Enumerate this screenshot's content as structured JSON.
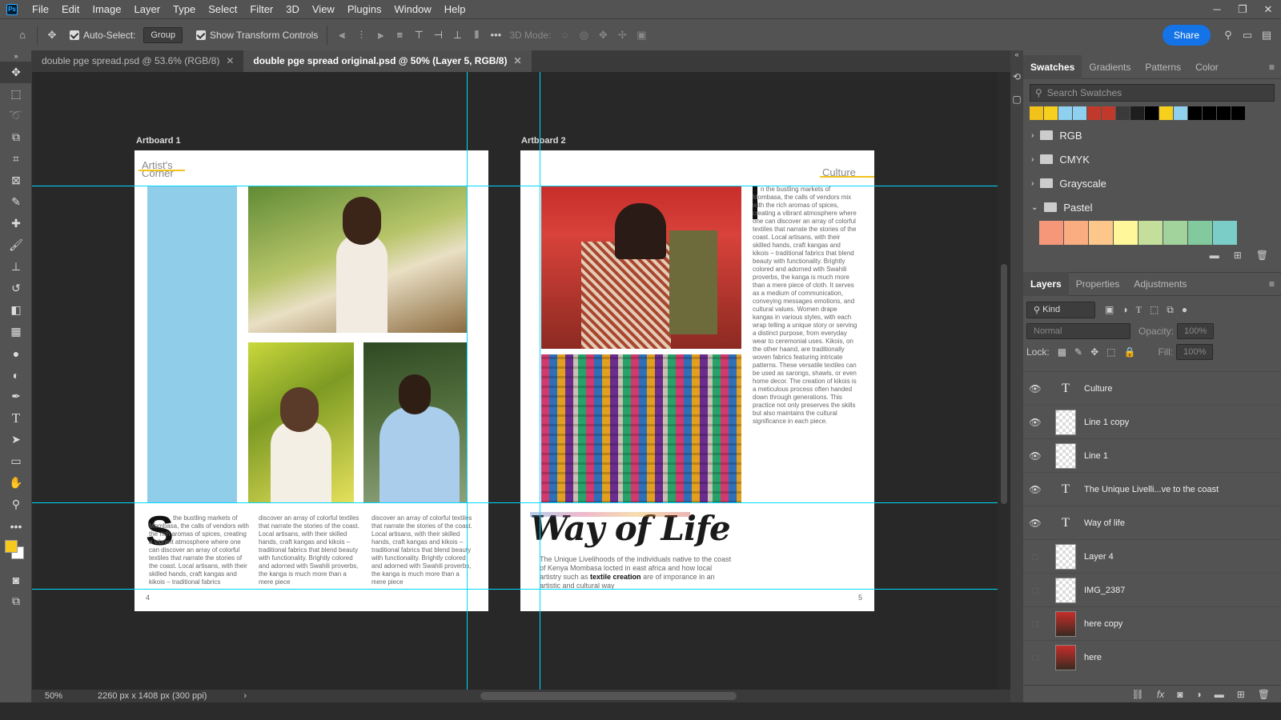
{
  "menubar": {
    "logo": "Ps",
    "items": [
      "File",
      "Edit",
      "Image",
      "Layer",
      "Type",
      "Select",
      "Filter",
      "3D",
      "View",
      "Plugins",
      "Window",
      "Help"
    ]
  },
  "options": {
    "auto_select": "Auto-Select:",
    "group": "Group",
    "transform": "Show Transform Controls",
    "mode3d": "3D Mode:",
    "share": "Share"
  },
  "tabs": [
    {
      "label": "double pge spread.psd @ 53.6% (RGB/8)"
    },
    {
      "label": "double pge spread original.psd @ 50% (Layer 5, RGB/8)"
    }
  ],
  "boards": {
    "left_label": "Artboard 1",
    "right_label": "Artboard 2"
  },
  "left_page": {
    "header": "Artist's Corner",
    "dropcap": "S",
    "col1": "the bustling markets of Mombasa, the calls of vendors with the rich aromas of spices, creating a vibrant atmosphere where one can discover an array of colorful textiles that narrate the stories of the coast. Local artisans, with their skilled hands, craft kangas and kikois – traditional fabrics",
    "col2": "discover an array of colorful textiles that narrate the stories of the coast. Local artisans, with their skilled hands, craft kangas and kikois – traditional fabrics that blend beauty with functionality. Brightly colored and adorned with Swahili proverbs, the kanga is much more than a mere piece",
    "col3": "discover an array of colorful textiles that narrate the stories of the coast. Local artisans, with their skilled hands, craft kangas and kikois – traditional fabrics that blend beauty with functionality. Brightly colored and adorned with Swahili proverbs, the kanga is much more than a mere piece",
    "page": "4"
  },
  "right_page": {
    "header": "Culture",
    "dropcap": "I",
    "body": "n the bustling markets of Mombasa, the calls of vendors mix with the rich aromas of spices, creating a vibrant atmosphere where one can discover an array of colorful textiles that narrate the stories of the coast. Local artisans, with their skilled hands, craft kangas and kikois – traditional fabrics that blend beauty with functionality. Brightly colored and adorned with Swahili proverbs, the kanga is much more than a mere piece of cloth. It serves as a medium of communication, conveying messages emotions, and cultural values. Women drape kangas in various styles, with each wrap telling a unique story or serving a distinct purpose, from everyday wear to ceremonial uses. Kikois, on the other haand, are traditionally woven fabrics featuring intricate patterns. These versatile textiles can be used as sarongs, shawls, or even home decor. The creation of kikois is a meticulous process often handed down through generations. This practice not only preserves the skills but also maintains the cultural significance in each piece.",
    "title": "Way of Life",
    "intro_a": "The Unique Livelihoods of the individuals native to the coast of Kenya Mombasa locted in east africa and how local artistry such as ",
    "intro_bold": "textile creation",
    "intro_b": " are of imporance in an artistic and cultural way",
    "page": "5"
  },
  "status": {
    "zoom": "50%",
    "size": "2260 px x 1408 px (300 ppi)"
  },
  "swatches": {
    "tabs": [
      "Swatches",
      "Gradients",
      "Patterns",
      "Color"
    ],
    "search": "Search Swatches",
    "recent": [
      "#f2c21b",
      "#f7d01e",
      "#8fd0ef",
      "#8fd0ef",
      "#c0392b",
      "#c0392b",
      "#3a3a3a",
      "#1e1e1e",
      "#000000",
      "#f7d01e",
      "#8fd0ef",
      "#000000",
      "#000000",
      "#000000",
      "#000000"
    ],
    "groups": [
      "RGB",
      "CMYK",
      "Grayscale",
      "Pastel"
    ],
    "pastel": [
      "#f7977a",
      "#f9ad81",
      "#fdc68a",
      "#fff79a",
      "#c4df9b",
      "#a2d39c",
      "#82ca9d",
      "#7bcdc8"
    ]
  },
  "layers": {
    "tabs": [
      "Layers",
      "Properties",
      "Adjustments"
    ],
    "kind": "Kind",
    "blend": "Normal",
    "opacity_label": "Opacity:",
    "opacity": "100%",
    "lock": "Lock:",
    "fill_label": "Fill:",
    "fill": "100%",
    "items": [
      {
        "name": "Culture"
      },
      {
        "name": "Line 1 copy"
      },
      {
        "name": "Line 1"
      },
      {
        "name": "The Unique Livelli...ve to  the coast"
      },
      {
        "name": "Way of life"
      },
      {
        "name": "Layer 4"
      },
      {
        "name": "IMG_2387"
      },
      {
        "name": "here copy"
      },
      {
        "name": "here"
      }
    ]
  }
}
